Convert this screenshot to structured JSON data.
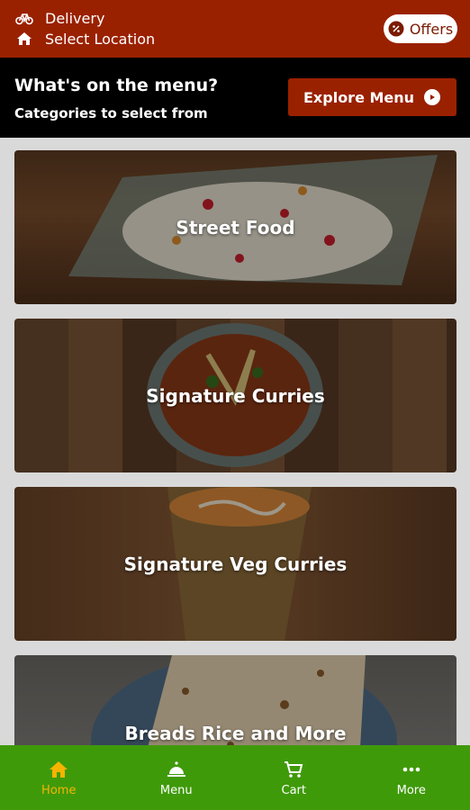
{
  "header": {
    "delivery_label": "Delivery",
    "location_label": "Select Location",
    "offers_label": "Offers"
  },
  "menu": {
    "title": "What's on the menu?",
    "subtitle": "Categories to select from",
    "explore_label": "Explore Menu"
  },
  "categories": [
    {
      "label": "Street Food"
    },
    {
      "label": "Signature Curries"
    },
    {
      "label": "Signature Veg Curries"
    },
    {
      "label": "Breads Rice and More"
    }
  ],
  "nav": [
    {
      "label": "Home",
      "icon": "home-icon",
      "active": true
    },
    {
      "label": "Menu",
      "icon": "cloche-icon",
      "active": false
    },
    {
      "label": "Cart",
      "icon": "cart-icon",
      "active": false
    },
    {
      "label": "More",
      "icon": "more-dots-icon",
      "active": false
    }
  ],
  "colors": {
    "header_bg": "#9a2100",
    "menubar_bg": "#000000",
    "nav_bg": "#3f9a0a",
    "active_nav": "#f6b400"
  }
}
